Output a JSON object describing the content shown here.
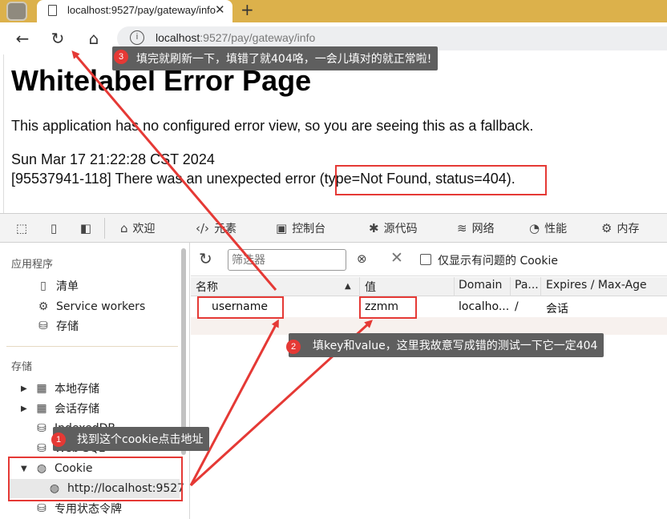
{
  "browser": {
    "tab_title": "localhost:9527/pay/gateway/info",
    "tab_close": "✕",
    "new_tab": "+",
    "nav": {
      "back": "←",
      "reload": "↻",
      "home": "⌂"
    },
    "url_host": "localhost",
    "url_rest": ":9527/pay/gateway/info"
  },
  "page": {
    "title": "Whitelabel Error Page",
    "line1": "This application has no configured error view, so you are seeing this as a fallback.",
    "line2": "Sun Mar 17 21:22:28 CST 2024",
    "line3_prefix": "[95537941-118] There was an unexpected error ",
    "line3_highlight": "(type=Not Found, status=404)."
  },
  "devtools": {
    "tabs": [
      {
        "label": "欢迎",
        "icon": "home-icon"
      },
      {
        "label": "元素",
        "icon": "code-icon"
      },
      {
        "label": "控制台",
        "icon": "console-icon"
      },
      {
        "label": "源代码",
        "icon": "bug-icon"
      },
      {
        "label": "网络",
        "icon": "wifi-icon"
      },
      {
        "label": "性能",
        "icon": "performance-icon"
      },
      {
        "label": "内存",
        "icon": "chip-icon"
      }
    ],
    "sidebar": {
      "section_app": "应用程序",
      "app_items": [
        "清单",
        "Service workers",
        "存储"
      ],
      "section_storage": "存储",
      "storage_items": [
        "本地存储",
        "会话存储",
        "IndexedDB",
        "Web SQL",
        "Cookie"
      ],
      "cookie_url": "http://localhost:9527",
      "trust_tokens": "专用状态令牌"
    },
    "cookies": {
      "filter_placeholder": "筛选器",
      "only_issues_label": "仅显示有问题的 Cookie",
      "columns": [
        "名称",
        "值",
        "Domain",
        "Pa...",
        "Expires / Max-Age"
      ],
      "rows": [
        {
          "name": "username",
          "value": "zzmm",
          "domain": "localho...",
          "path": "/",
          "expires": "会话"
        }
      ]
    }
  },
  "annotations": {
    "c1_num": "1",
    "c1_text": "找到这个cookie点击地址",
    "c2_num": "2",
    "c2_text": "填key和value，这里我故意写成错的测试一下它一定404",
    "c3_num": "3",
    "c3_text": "填完就刷新一下，填错了就404咯，一会儿填对的就正常啦!",
    "color": "#e53935"
  }
}
